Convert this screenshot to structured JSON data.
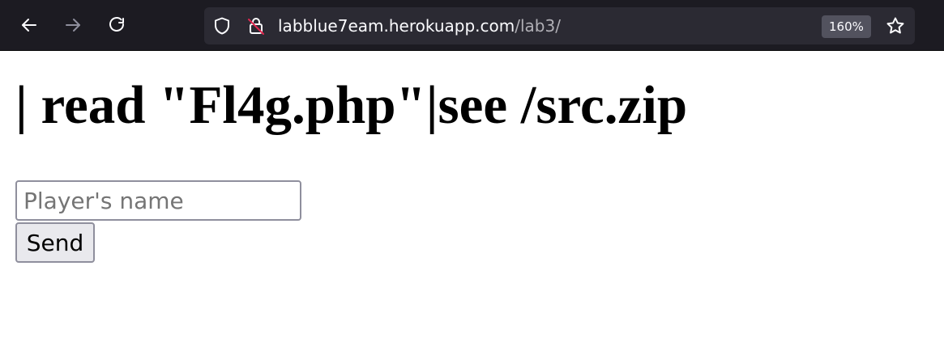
{
  "browser": {
    "nav": {
      "back_icon": "arrow-left-icon",
      "forward_icon": "arrow-right-icon",
      "reload_icon": "reload-icon"
    },
    "urlbar": {
      "domain": "labblue7eam.herokuapp.com",
      "path": "/lab3/",
      "zoom": "160%",
      "shield_icon": "shield-icon",
      "lock_icon": "insecure-lock-icon",
      "bookmark_icon": "star-icon"
    }
  },
  "page": {
    "heading": "| read \"Fl4g.php\"|see /src.zip",
    "form": {
      "name_placeholder": "Player's name",
      "name_value": "",
      "send_label": "Send"
    }
  },
  "colors": {
    "toolbar_bg": "#1c1b22",
    "urlbar_bg": "#2b2a33",
    "insecure_red": "#e22850"
  }
}
